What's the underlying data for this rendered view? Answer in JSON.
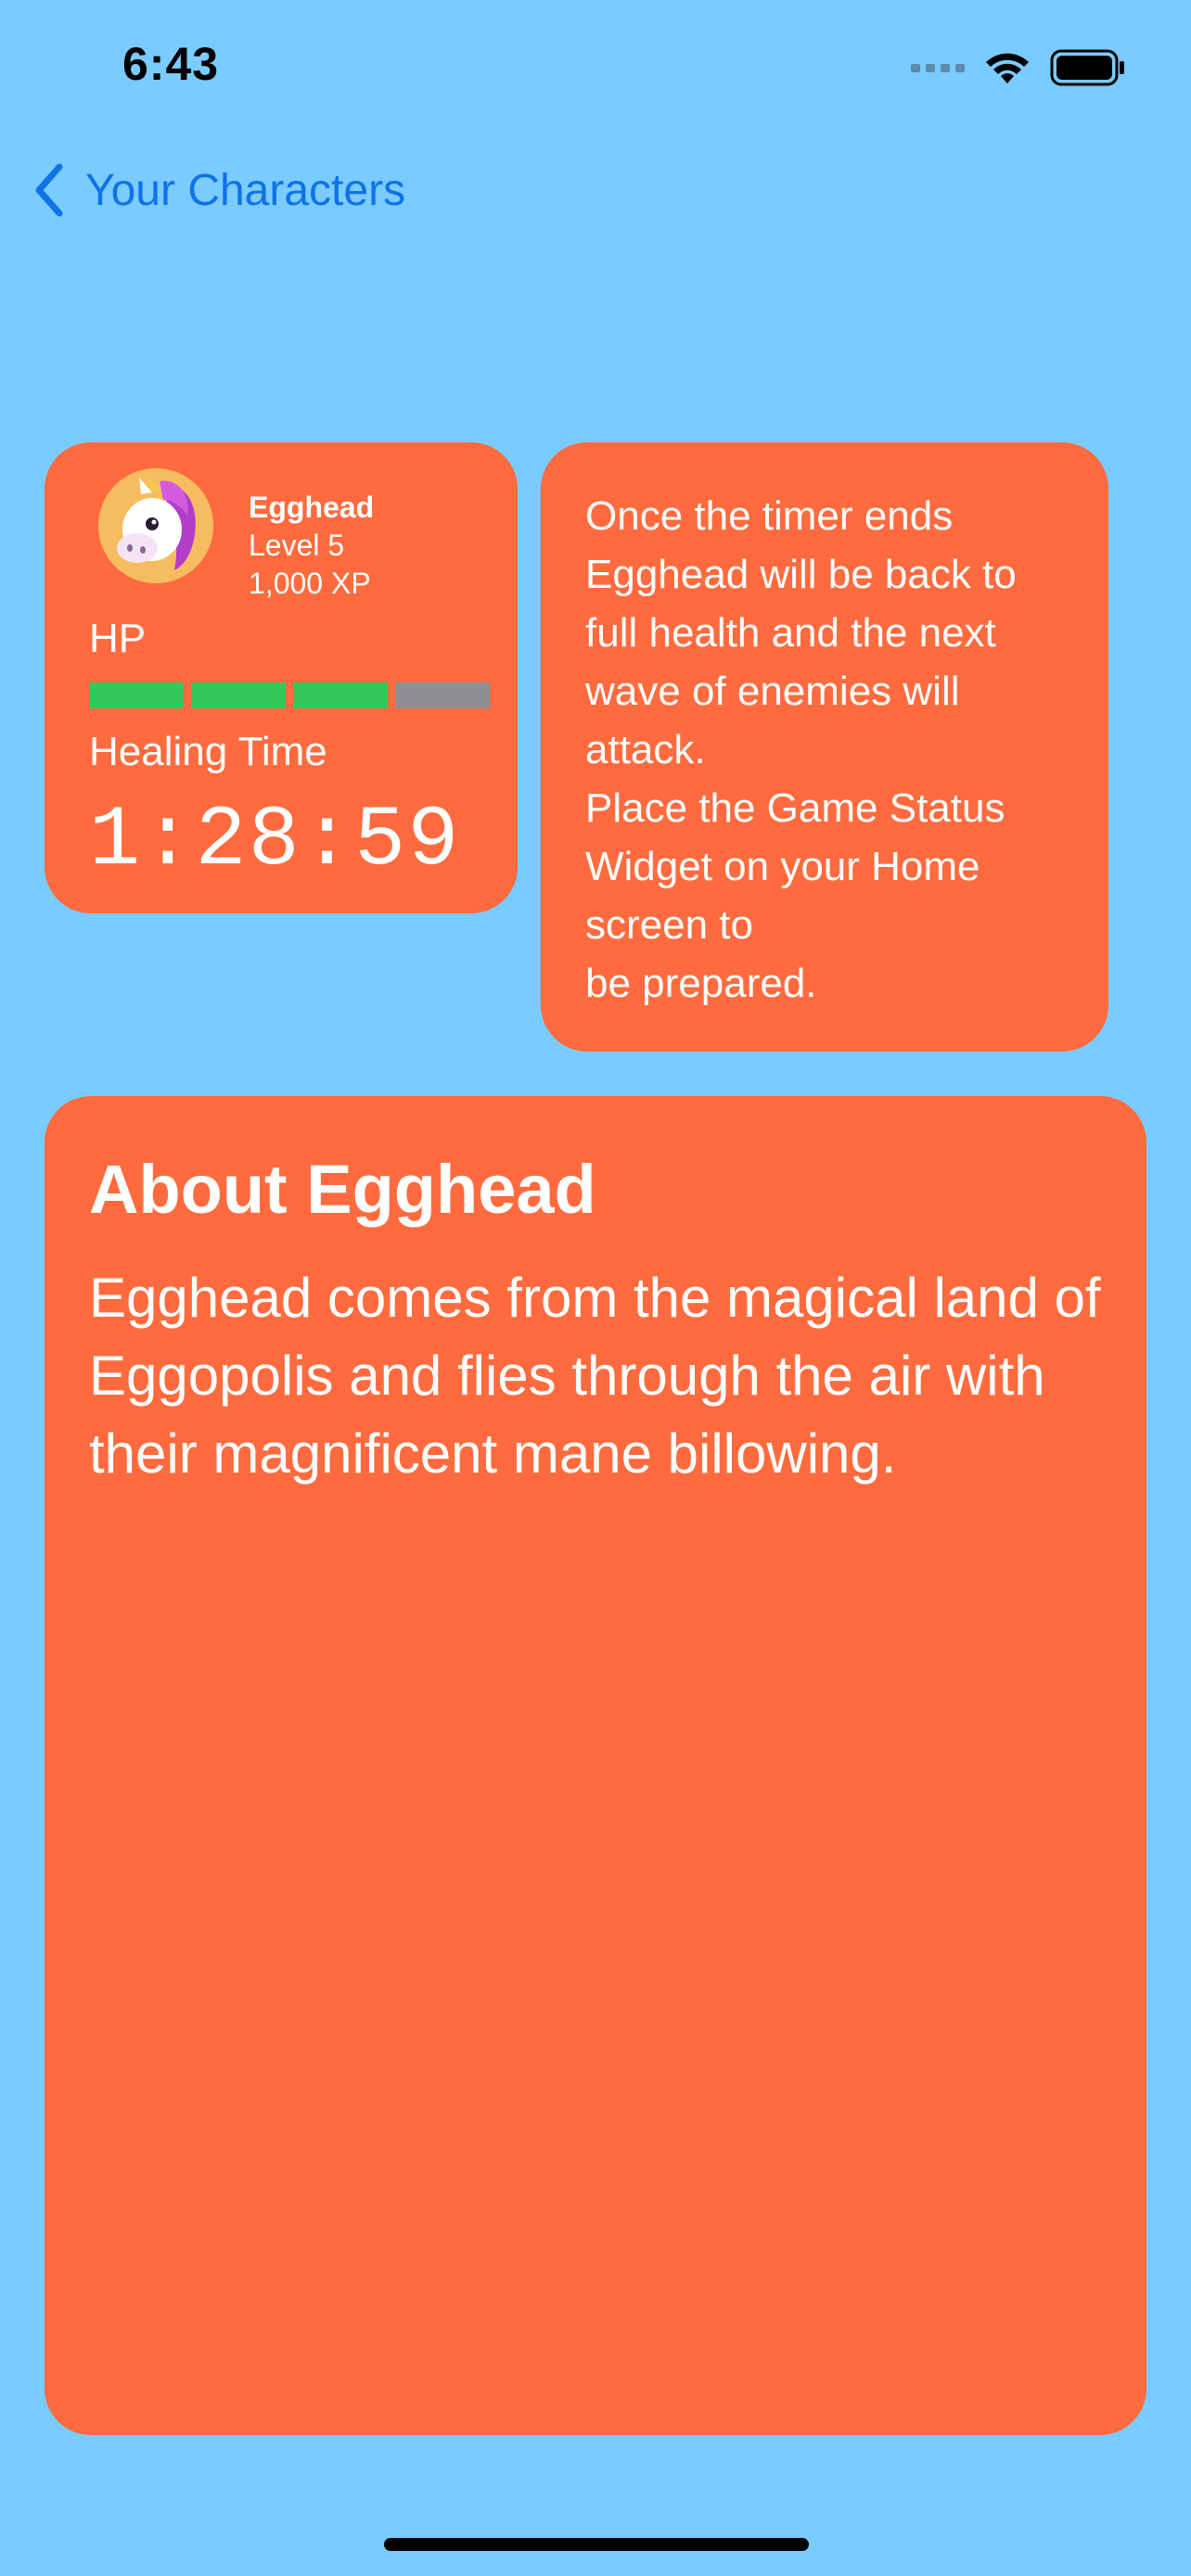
{
  "status_bar": {
    "time": "6:43"
  },
  "nav": {
    "back_label": "Your Characters"
  },
  "character": {
    "name": "Egghead",
    "level": "Level 5",
    "xp": "1,000 XP",
    "avatar": "unicorn-avatar",
    "hp_label": "HP",
    "hp_segments": [
      {
        "filled": true,
        "color": "#34C759"
      },
      {
        "filled": true,
        "color": "#34C759"
      },
      {
        "filled": true,
        "color": "#34C759"
      },
      {
        "filled": false,
        "color": "#8E8E93"
      }
    ],
    "healing_label": "Healing Time",
    "timer": "1:28:59"
  },
  "info": {
    "line1": "Once the timer ends Egghead will be back to full health and the next wave of enemies will attack.",
    "line2": "Place the Game Status Widget on your Home screen to",
    "line3": "be prepared."
  },
  "about": {
    "title": "About Egghead",
    "body": "Egghead comes from the magical land of Eggopolis and flies through the air with their magnificent mane billowing."
  },
  "colors": {
    "background": "#7ACBFF",
    "card": "#FF6B3E",
    "accent": "#0F72E6",
    "hp_full": "#34C759",
    "hp_empty": "#8E8E93"
  }
}
